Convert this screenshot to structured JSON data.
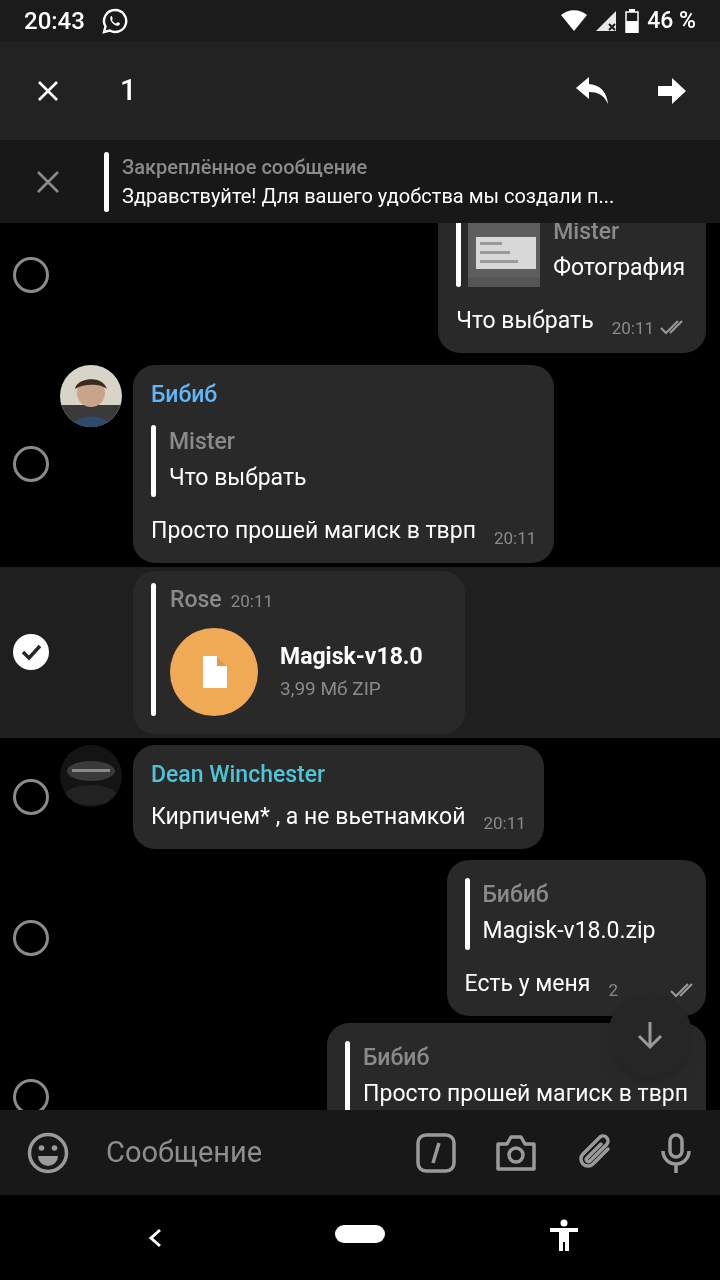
{
  "status_bar": {
    "time": "20:43",
    "battery": "46 %"
  },
  "action_bar": {
    "selected_count": "1"
  },
  "pinned": {
    "title": "Закреплённое сообщение",
    "text": "Здравствуйте! Для вашего удобства мы создали п..."
  },
  "messages": [
    {
      "kind": "text",
      "outgoing": true,
      "selected": false,
      "reply": {
        "name": "Mister",
        "text": "Фотография"
      },
      "text": "Что выбрать",
      "time": "20:11",
      "read": true
    },
    {
      "kind": "text",
      "outgoing": false,
      "selected": false,
      "avatar": true,
      "sender": "Бибиб",
      "color": "#64b5f6",
      "reply": {
        "kind": "text",
        "name": "Mister",
        "text": "Что выбрать"
      },
      "text": "Просто прошей магиск в тврп",
      "time": "20:11"
    },
    {
      "kind": "file",
      "outgoing": false,
      "selected": true,
      "avatar": false,
      "sender": "Rose",
      "time": "20:11",
      "file": {
        "name": "Magisk-v18.0",
        "size": "3,99 Мб ZIP"
      }
    },
    {
      "kind": "text",
      "outgoing": false,
      "selected": false,
      "avatar": true,
      "sender": "Dean Winchester",
      "color": "#4fc3d7",
      "text": "Кирпичем* , а не вьетнамкой",
      "time": "20:11"
    },
    {
      "kind": "text",
      "outgoing": true,
      "selected": false,
      "reply": {
        "kind": "text",
        "name": "Бибиб",
        "text": "Magisk-v18.0.zip"
      },
      "text": "Есть у меня",
      "time": "2",
      "read": true
    },
    {
      "kind": "text",
      "outgoing": true,
      "selected": false,
      "reply": {
        "kind": "text",
        "name": "Бибиб",
        "text": "Просто прошей магиск в тврп"
      }
    }
  ],
  "composer": {
    "placeholder": "Сообщение"
  }
}
